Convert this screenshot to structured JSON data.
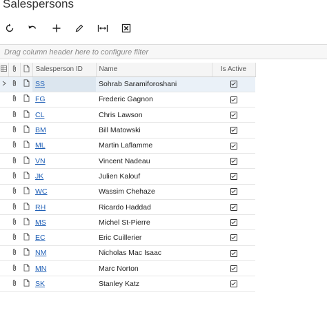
{
  "page": {
    "title": "Salespersons"
  },
  "toolbar": {
    "buttons": [
      {
        "name": "refresh",
        "icon": "refresh-icon"
      },
      {
        "name": "undo",
        "icon": "undo-icon"
      },
      {
        "name": "add",
        "icon": "plus-icon"
      },
      {
        "name": "edit",
        "icon": "pencil-icon"
      },
      {
        "name": "fit-columns",
        "icon": "fit-width-icon"
      },
      {
        "name": "export-excel",
        "icon": "excel-icon"
      }
    ]
  },
  "filter": {
    "placeholder": "Drag column header here to configure filter"
  },
  "grid": {
    "columns": {
      "salesperson_id": "Salesperson ID",
      "name": "Name",
      "is_active": "Is Active"
    },
    "rows": [
      {
        "id": "SS",
        "name": "Sohrab Saramiforoshani",
        "active": true
      },
      {
        "id": "FG",
        "name": "Frederic Gagnon",
        "active": true
      },
      {
        "id": "CL",
        "name": "Chris Lawson",
        "active": true
      },
      {
        "id": "BM",
        "name": "Bill Matowski",
        "active": true
      },
      {
        "id": "ML",
        "name": "Martin Laflamme",
        "active": true
      },
      {
        "id": "VN",
        "name": "Vincent Nadeau",
        "active": true
      },
      {
        "id": "JK",
        "name": "Julien Kalouf",
        "active": true
      },
      {
        "id": "WC",
        "name": "Wassim Chehaze",
        "active": true
      },
      {
        "id": "RH",
        "name": "Ricardo Haddad",
        "active": true
      },
      {
        "id": "MS",
        "name": "Michel St-Pierre",
        "active": true
      },
      {
        "id": "EC",
        "name": "Eric Cuillerier",
        "active": true
      },
      {
        "id": "NM",
        "name": "Nicholas Mac Isaac",
        "active": true
      },
      {
        "id": "MN",
        "name": "Marc Norton",
        "active": true
      },
      {
        "id": "SK",
        "name": "Stanley Katz",
        "active": true
      }
    ]
  }
}
